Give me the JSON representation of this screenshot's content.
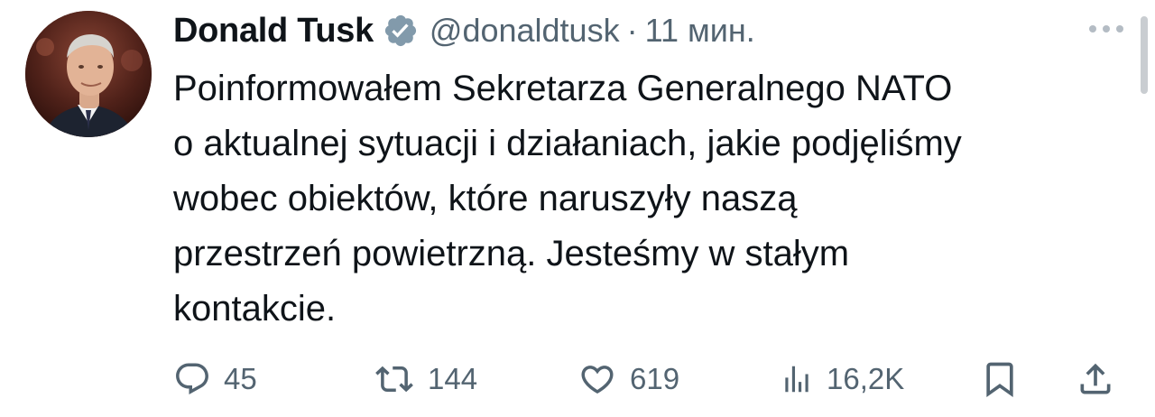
{
  "author": {
    "name": "Donald Tusk",
    "handle": "@donaldtusk",
    "separator": "·",
    "timestamp": "11 мин.",
    "verified": true,
    "avatar_alt": "Donald Tusk profile photo"
  },
  "tweet": {
    "lines": [
      "Poinformowałem Sekretarza Generalnego NATO",
      "o aktualnej sytuacji i działaniach, jakie podjęliśmy",
      "wobec obiektów, które naruszyły naszą",
      "przestrzeń powietrzną. Jesteśmy w stałym",
      "kontakcie."
    ]
  },
  "actions": {
    "replies": "45",
    "reposts": "144",
    "likes": "619",
    "views": "16,2K"
  },
  "icons": {
    "reply": "reply-icon",
    "repost": "repost-icon",
    "like": "heart-icon",
    "views": "views-icon",
    "bookmark": "bookmark-icon",
    "share": "share-icon",
    "more": "more-icon",
    "verified": "verified-badge-icon"
  },
  "colors": {
    "text": "#0f1419",
    "secondary": "#536471",
    "background": "#ffffff"
  }
}
